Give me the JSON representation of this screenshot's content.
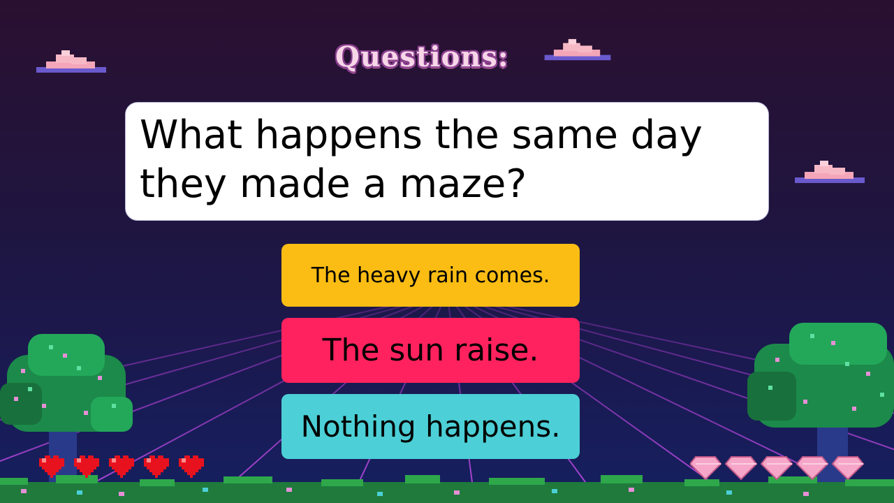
{
  "header": {
    "title": "Questions:"
  },
  "question": {
    "text": "What happens the same day they made a maze?"
  },
  "answers": [
    {
      "label": "The heavy rain comes.",
      "color": "#fbbd14"
    },
    {
      "label": "The sun raise.",
      "color": "#ff225e"
    },
    {
      "label": "Nothing happens.",
      "color": "#4ccfd6"
    }
  ],
  "hud": {
    "lives": 5,
    "gems": 5
  },
  "colors": {
    "grid": "#b63cdc",
    "grass": "#2ea84a",
    "heart": "#e8121e",
    "gem": "#f6a6c8"
  }
}
